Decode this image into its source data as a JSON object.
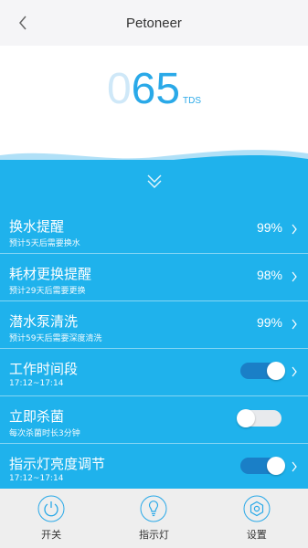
{
  "header": {
    "title": "Petoneer",
    "back_icon": "chevron-left-icon"
  },
  "tds": {
    "lead_digit": "0",
    "value": "65",
    "unit": "TDS"
  },
  "expand_icon": "double-chevron-down-icon",
  "rows": [
    {
      "title": "换水提醒",
      "subtitle": "预计5天后需要换水",
      "percent": "99%"
    },
    {
      "title": "耗材更换提醒",
      "subtitle": "预计29天后需要更换",
      "percent": "98%"
    },
    {
      "title": "潜水泵清洗",
      "subtitle": "预计59天后需要深度清洗",
      "percent": "99%"
    },
    {
      "title": "工作时间段",
      "subtitle": "17:12~17:14",
      "toggle_on": true
    },
    {
      "title": "立即杀菌",
      "subtitle": "每次杀菌时长3分钟",
      "toggle_on": false
    },
    {
      "title": "指示灯亮度调节",
      "subtitle": "17:12~17:14",
      "toggle_on": true
    }
  ],
  "tabs": [
    {
      "label": "开关",
      "icon": "power-icon"
    },
    {
      "label": "指示灯",
      "icon": "lightbulb-icon"
    },
    {
      "label": "设置",
      "icon": "gear-icon"
    }
  ],
  "colors": {
    "accent": "#1fb2ec",
    "toggle_on": "#1a7fc7",
    "tds_value": "#2aa9e8",
    "tab_icon": "#2aa9e8"
  }
}
